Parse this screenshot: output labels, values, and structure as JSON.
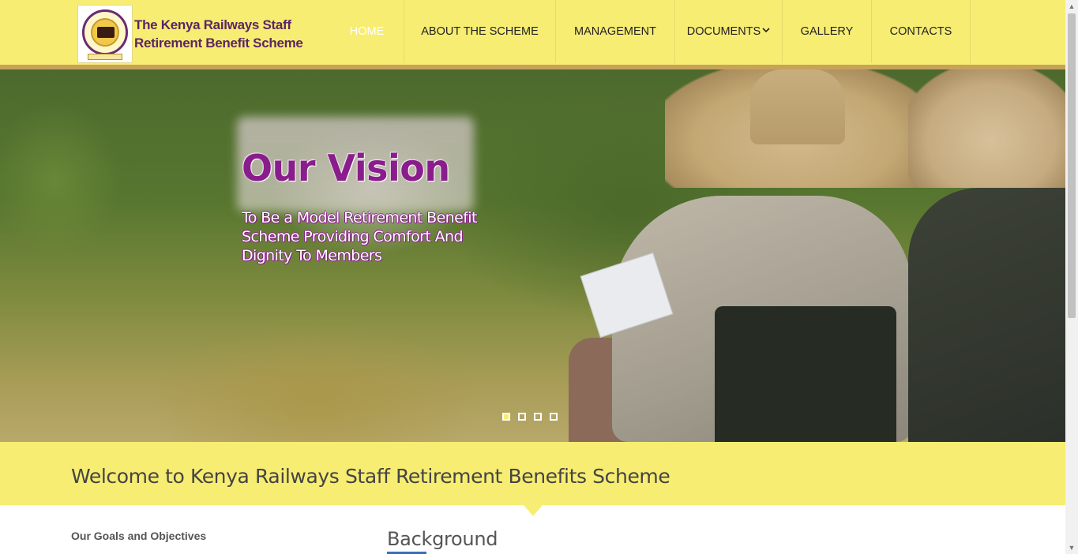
{
  "header": {
    "logo_line1": "The Kenya Railways Staff",
    "logo_line2": "Retirement Benefit Scheme",
    "logo_icon": "railway-seal-logo"
  },
  "nav": {
    "items": [
      {
        "label": "HOME",
        "active": true
      },
      {
        "label": "ABOUT THE SCHEME",
        "active": false
      },
      {
        "label": "MANAGEMENT",
        "active": false
      },
      {
        "label": "DOCUMENTS",
        "active": false,
        "has_dropdown": true,
        "dropdown_icon": "chevron-down-icon"
      },
      {
        "label": "GALLERY",
        "active": false
      },
      {
        "label": "CONTACTS",
        "active": false
      }
    ]
  },
  "slider": {
    "title": "Our Vision",
    "subtitle": "To Be a Model Retirement Benefit Scheme Providing Comfort And Dignity To Members",
    "slide_count": 4,
    "active_index": 0
  },
  "welcome": {
    "heading": "Welcome to Kenya Railways Staff Retirement Benefits Scheme"
  },
  "content": {
    "goals_heading": "Our Goals and Objectives",
    "background_heading": "Background"
  },
  "colors": {
    "header_bg": "#f7ed72",
    "header_bar": "#c7a35a",
    "brand_purple": "#8a1d8c",
    "active_dot": "#f7ed72"
  },
  "scrollbar": {
    "up_icon": "arrow-up-icon",
    "down_icon": "arrow-down-icon"
  }
}
